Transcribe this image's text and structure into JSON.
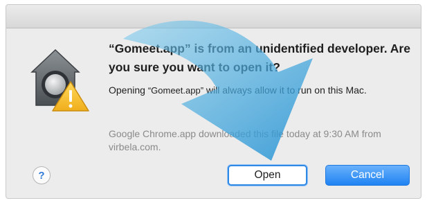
{
  "dialog": {
    "title": "“Gomeet.app” is from an unidentified developer. Are you sure you want to open it?",
    "message_prefix": "Opening ",
    "message_app": "“Gomeet.app”",
    "message_suffix": " will always allow it to run on this Mac.",
    "source": "Google Chrome.app downloaded this file today at 9:30 AM from virbela.com.",
    "help_label": "?",
    "open_label": "Open",
    "cancel_label": "Cancel",
    "icon": "gatekeeper-caution-icon",
    "overlay_icon": "curved-arrow-icon"
  },
  "colors": {
    "accent": "#2d88e6",
    "cancel_button": "#1f83f3",
    "warning": "#f6c436",
    "arrow": "#3aa4dc"
  }
}
